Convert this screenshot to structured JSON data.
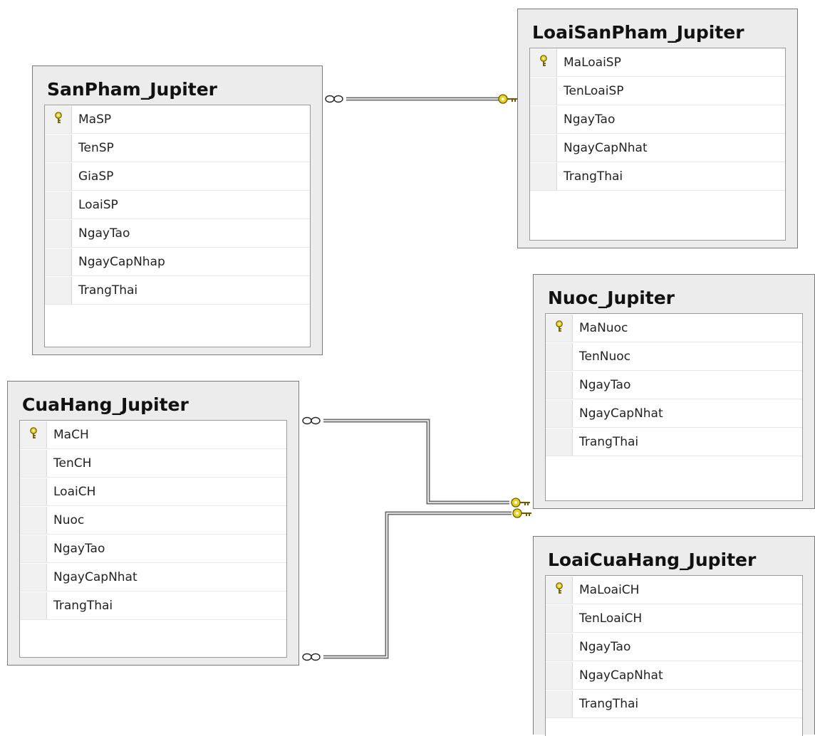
{
  "tables": {
    "sanpham": {
      "title": "SanPham_Jupiter",
      "columns": [
        {
          "name": "MaSP",
          "primary_key": true
        },
        {
          "name": "TenSP",
          "primary_key": false
        },
        {
          "name": "GiaSP",
          "primary_key": false
        },
        {
          "name": "LoaiSP",
          "primary_key": false
        },
        {
          "name": "NgayTao",
          "primary_key": false
        },
        {
          "name": "NgayCapNhap",
          "primary_key": false
        },
        {
          "name": "TrangThai",
          "primary_key": false
        }
      ]
    },
    "loaisanpham": {
      "title": "LoaiSanPham_Jupiter",
      "columns": [
        {
          "name": "MaLoaiSP",
          "primary_key": true
        },
        {
          "name": "TenLoaiSP",
          "primary_key": false
        },
        {
          "name": "NgayTao",
          "primary_key": false
        },
        {
          "name": "NgayCapNhat",
          "primary_key": false
        },
        {
          "name": "TrangThai",
          "primary_key": false
        }
      ]
    },
    "nuoc": {
      "title": "Nuoc_Jupiter",
      "columns": [
        {
          "name": "MaNuoc",
          "primary_key": true
        },
        {
          "name": "TenNuoc",
          "primary_key": false
        },
        {
          "name": "NgayTao",
          "primary_key": false
        },
        {
          "name": "NgayCapNhat",
          "primary_key": false
        },
        {
          "name": "TrangThai",
          "primary_key": false
        }
      ]
    },
    "cuahang": {
      "title": "CuaHang_Jupiter",
      "columns": [
        {
          "name": "MaCH",
          "primary_key": true
        },
        {
          "name": "TenCH",
          "primary_key": false
        },
        {
          "name": "LoaiCH",
          "primary_key": false
        },
        {
          "name": "Nuoc",
          "primary_key": false
        },
        {
          "name": "NgayTao",
          "primary_key": false
        },
        {
          "name": "NgayCapNhat",
          "primary_key": false
        },
        {
          "name": "TrangThai",
          "primary_key": false
        }
      ]
    },
    "loaicuahang": {
      "title": "LoaiCuaHang_Jupiter",
      "columns": [
        {
          "name": "MaLoaiCH",
          "primary_key": true
        },
        {
          "name": "TenLoaiCH",
          "primary_key": false
        },
        {
          "name": "NgayTao",
          "primary_key": false
        },
        {
          "name": "NgayCapNhat",
          "primary_key": false
        },
        {
          "name": "TrangThai",
          "primary_key": false
        }
      ]
    }
  },
  "relationships": [
    {
      "from": "SanPham_Jupiter",
      "to": "LoaiSanPham_Jupiter",
      "many_end": "infinity-icon",
      "one_end": "key-icon"
    },
    {
      "from": "CuaHang_Jupiter",
      "to": "Nuoc_Jupiter",
      "many_end": "infinity-icon",
      "one_end": "key-icon"
    },
    {
      "from": "CuaHang_Jupiter",
      "to": "LoaiCuaHang_Jupiter",
      "many_end": "infinity-icon",
      "one_end": "key-icon"
    }
  ],
  "colors": {
    "key": "#e8d21a",
    "line": "#6e6e6e",
    "table_bg": "#ececec"
  }
}
